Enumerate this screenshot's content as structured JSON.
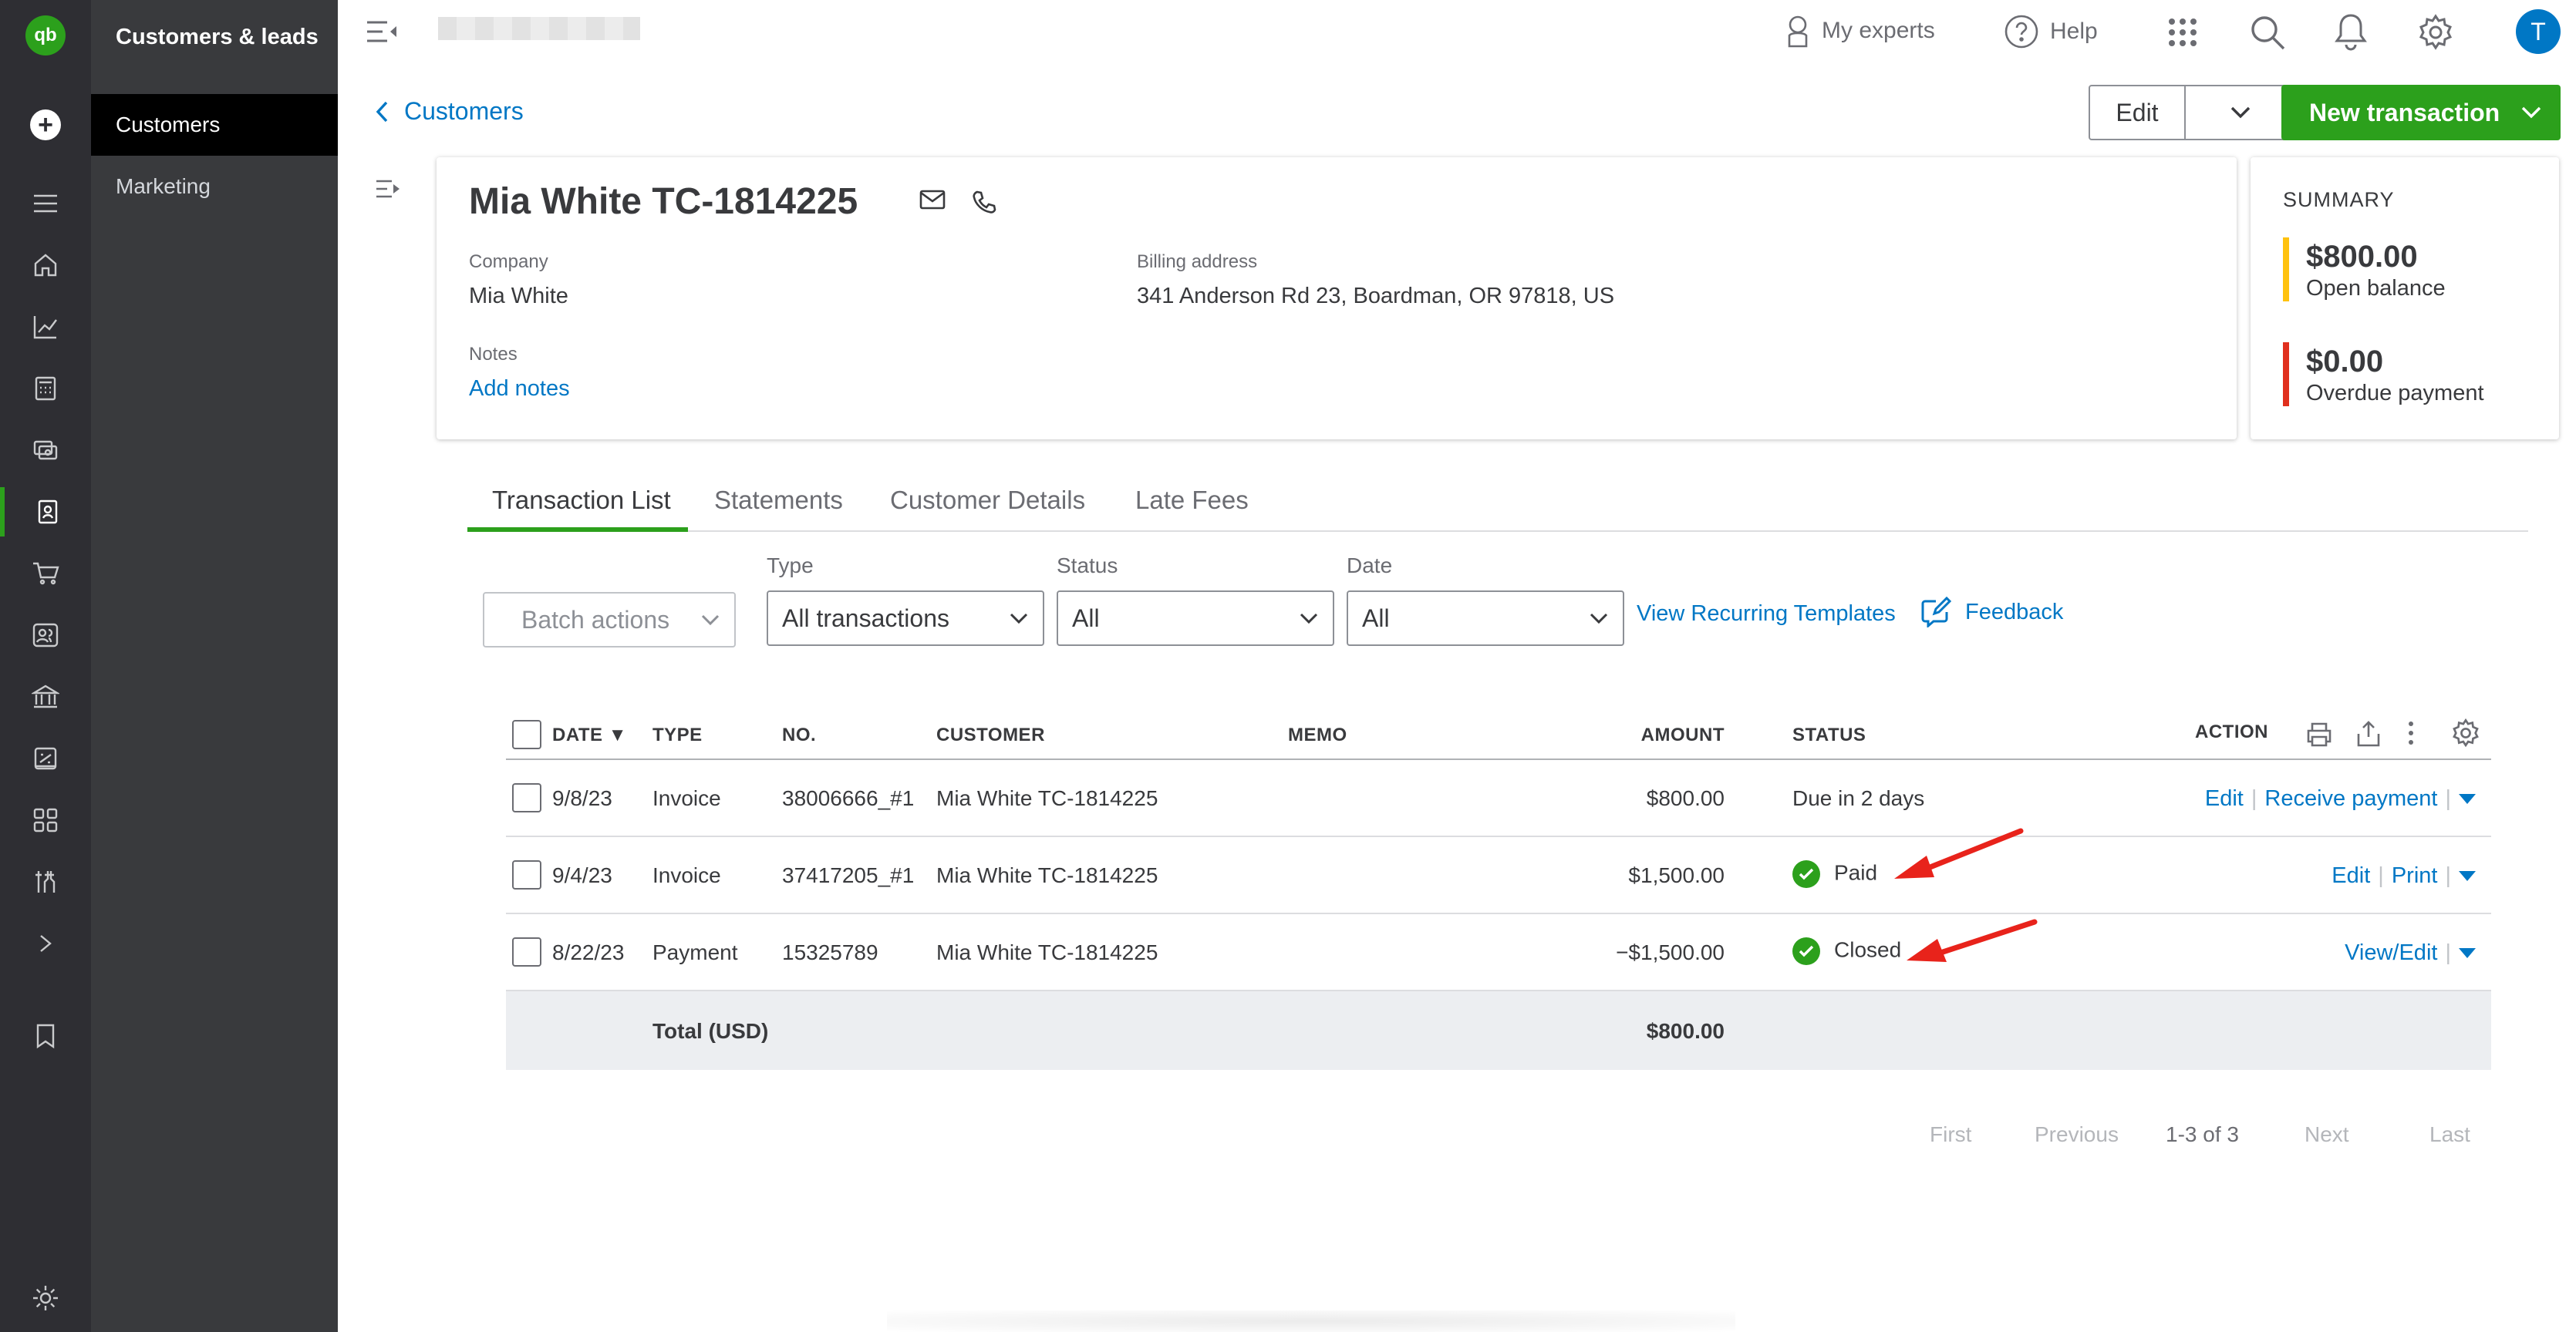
{
  "app": {
    "logo_text": "qb"
  },
  "nav": {
    "section_title": "Customers & leads",
    "items": [
      {
        "label": "Customers",
        "active": true
      },
      {
        "label": "Marketing",
        "active": false
      }
    ]
  },
  "rail_icons": [
    "create-icon",
    "menu-icon",
    "home-icon",
    "chart-icon",
    "calculator-icon",
    "expenses-icon",
    "customers-icon",
    "sales-icon",
    "team-icon",
    "bank-icon",
    "taxes-icon",
    "apps-icon",
    "tools-icon",
    "expand-icon",
    "bookmark-icon",
    "settings-icon"
  ],
  "topbar": {
    "my_experts": "My experts",
    "help": "Help",
    "avatar_initial": "T"
  },
  "header": {
    "back_label": "Customers",
    "edit_label": "Edit",
    "new_transaction_label": "New transaction"
  },
  "customer": {
    "name": "Mia White TC-1814225",
    "company_label": "Company",
    "company": "Mia White",
    "billing_label": "Billing address",
    "billing": "341 Anderson Rd 23, Boardman, OR 97818, US",
    "notes_label": "Notes",
    "add_notes": "Add notes"
  },
  "summary": {
    "title": "SUMMARY",
    "open_balance": "$800.00",
    "open_balance_label": "Open balance",
    "overdue": "$0.00",
    "overdue_label": "Overdue payment",
    "colors": {
      "open": "#ffc20e",
      "overdue": "#e0301e"
    }
  },
  "tabs": [
    "Transaction List",
    "Statements",
    "Customer Details",
    "Late Fees"
  ],
  "filters": {
    "batch_actions": "Batch actions",
    "type_label": "Type",
    "type_value": "All transactions",
    "status_label": "Status",
    "status_value": "All",
    "date_label": "Date",
    "date_value": "All",
    "recurring_link": "View Recurring Templates",
    "feedback_link": "Feedback"
  },
  "table": {
    "headers": {
      "date": "DATE ▼",
      "type": "TYPE",
      "no": "NO.",
      "customer": "CUSTOMER",
      "memo": "MEMO",
      "amount": "AMOUNT",
      "status": "STATUS",
      "action": "ACTION"
    },
    "rows": [
      {
        "date": "9/8/23",
        "type": "Invoice",
        "no": "38006666_#1",
        "customer": "Mia White TC-1814225",
        "memo": "",
        "amount": "$800.00",
        "status": "Due in 2 days",
        "actions": [
          "Edit",
          "Receive payment"
        ]
      },
      {
        "date": "9/4/23",
        "type": "Invoice",
        "no": "37417205_#1",
        "customer": "Mia White TC-1814225",
        "memo": "",
        "amount": "$1,500.00",
        "status": "Paid",
        "actions": [
          "Edit",
          "Print"
        ]
      },
      {
        "date": "8/22/23",
        "type": "Payment",
        "no": "15325789",
        "customer": "Mia White TC-1814225",
        "memo": "",
        "amount": "−$1,500.00",
        "status": "Closed",
        "actions": [
          "View/Edit"
        ]
      }
    ],
    "total_label": "Total (USD)",
    "total_amount": "$800.00"
  },
  "pagination": {
    "first": "First",
    "previous": "Previous",
    "range": "1-3 of 3",
    "next": "Next",
    "last": "Last"
  },
  "colors": {
    "brand_green": "#2ca01c",
    "link_blue": "#0077c5",
    "annotation_red": "#e8231b"
  }
}
